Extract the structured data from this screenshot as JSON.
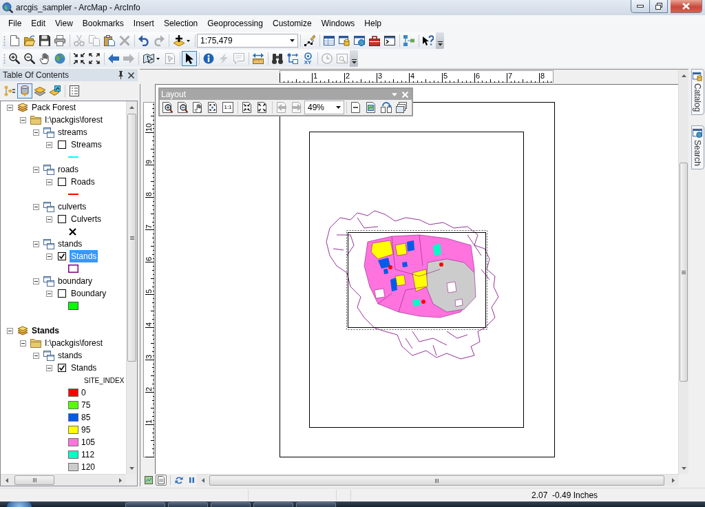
{
  "window": {
    "title": "arcgis_sampler - ArcMap - ArcInfo"
  },
  "menu": [
    "File",
    "Edit",
    "View",
    "Bookmarks",
    "Insert",
    "Selection",
    "Geoprocessing",
    "Customize",
    "Windows",
    "Help"
  ],
  "standard_toolbar": {
    "tools": [
      {
        "disabled": false
      },
      {
        "disabled": false
      },
      {
        "disabled": false
      },
      {
        "disabled": false
      },
      {
        "disabled": true
      },
      {
        "disabled": true
      },
      {
        "disabled": false
      },
      {
        "disabled": true
      },
      {
        "disabled": false
      },
      {
        "disabled": true
      },
      {
        "disabled": false
      },
      {
        "disabled": false
      },
      {
        "disabled": false
      },
      {
        "disabled": false
      },
      {
        "disabled": false
      },
      {
        "disabled": false
      },
      {
        "disabled": false
      },
      {
        "disabled": false
      },
      {
        "disabled": false
      }
    ],
    "scale": "1:75,479"
  },
  "tools_toolbar": {
    "tools": [
      {
        "disabled": false,
        "selected": false
      },
      {
        "disabled": false,
        "selected": false
      },
      {
        "disabled": false,
        "selected": false
      },
      {
        "disabled": false,
        "selected": false
      },
      {
        "disabled": false,
        "selected": false
      },
      {
        "disabled": false,
        "selected": false
      },
      {
        "disabled": false,
        "selected": false
      },
      {
        "disabled": true,
        "selected": false
      },
      {
        "disabled": false,
        "selected": false
      },
      {
        "disabled": true,
        "selected": false
      },
      {
        "disabled": false,
        "selected": true
      },
      {
        "disabled": false,
        "selected": false
      },
      {
        "disabled": true,
        "selected": false
      },
      {
        "disabled": true,
        "selected": false
      },
      {
        "disabled": false,
        "selected": false
      },
      {
        "disabled": false,
        "selected": false
      },
      {
        "disabled": false,
        "selected": false
      },
      {
        "disabled": false,
        "selected": false,
        "label": "XY"
      },
      {
        "disabled": true,
        "selected": false
      },
      {
        "disabled": true,
        "selected": false
      }
    ]
  },
  "table_of_contents": {
    "title": "Table Of Contents",
    "view_buttons": [
      {
        "selected": false
      },
      {
        "selected": true
      },
      {
        "selected": false
      },
      {
        "selected": false
      }
    ],
    "tree": [
      {
        "kind": "data_frame",
        "label": "Pack Forest",
        "active": false,
        "expanded": true,
        "children": [
          {
            "kind": "folder",
            "label": "I:\\packgis\\forest",
            "expanded": true,
            "children": [
              {
                "kind": "group",
                "label": "streams",
                "expanded": true,
                "children": [
                  {
                    "kind": "layer",
                    "label": "Streams",
                    "checked": false,
                    "selected": false,
                    "expanded": true,
                    "symbol": {
                      "kind": "line",
                      "color": "#00ffff"
                    }
                  }
                ]
              },
              {
                "kind": "group",
                "label": "roads",
                "expanded": true,
                "children": [
                  {
                    "kind": "layer",
                    "label": "Roads",
                    "checked": false,
                    "selected": false,
                    "expanded": true,
                    "symbol": {
                      "kind": "line",
                      "color": "#ff0000"
                    }
                  }
                ]
              },
              {
                "kind": "group",
                "label": "culverts",
                "expanded": true,
                "children": [
                  {
                    "kind": "layer",
                    "label": "Culverts",
                    "checked": false,
                    "selected": false,
                    "expanded": true,
                    "symbol": {
                      "kind": "cross",
                      "color": "#000000"
                    }
                  }
                ]
              },
              {
                "kind": "group",
                "label": "stands",
                "expanded": true,
                "children": [
                  {
                    "kind": "layer",
                    "label": "Stands",
                    "checked": true,
                    "selected": true,
                    "expanded": true,
                    "symbol": {
                      "kind": "outline",
                      "color": "#800080"
                    }
                  }
                ]
              },
              {
                "kind": "group",
                "label": "boundary",
                "expanded": true,
                "children": [
                  {
                    "kind": "layer",
                    "label": "Boundary",
                    "checked": false,
                    "selected": false,
                    "expanded": true,
                    "symbol": {
                      "kind": "fill",
                      "color": "#00ff00"
                    }
                  }
                ]
              }
            ]
          }
        ]
      },
      {
        "kind": "data_frame",
        "label": "Stands",
        "active": true,
        "expanded": true,
        "children": [
          {
            "kind": "folder",
            "label": "I:\\packgis\\forest",
            "expanded": true,
            "children": [
              {
                "kind": "group",
                "label": "stands",
                "expanded": true,
                "children": [
                  {
                    "kind": "layer",
                    "label": "Stands",
                    "checked": true,
                    "selected": false,
                    "expanded": true,
                    "legend": {
                      "heading": "SITE_INDEX",
                      "classes": [
                        {
                          "label": "0",
                          "color": "#ff0000"
                        },
                        {
                          "label": "75",
                          "color": "#55ff00"
                        },
                        {
                          "label": "85",
                          "color": "#005ce6"
                        },
                        {
                          "label": "95",
                          "color": "#ffff00"
                        },
                        {
                          "label": "105",
                          "color": "#ff73df"
                        },
                        {
                          "label": "112",
                          "color": "#00ffc5"
                        },
                        {
                          "label": "120",
                          "color": "#cccccc"
                        }
                      ]
                    }
                  }
                ]
              }
            ]
          }
        ]
      }
    ]
  },
  "layout_view": {
    "horizontal_ruler": [
      "1",
      "2",
      "3",
      "4",
      "5",
      "6",
      "7",
      "8"
    ],
    "vertical_ruler": [
      "10",
      "9",
      "8",
      "7",
      "6",
      "5",
      "4",
      "3",
      "2",
      "1"
    ],
    "layout_toolbar": {
      "title": "Layout",
      "tools": [
        {
          "disabled": false
        },
        {
          "disabled": false
        },
        {
          "disabled": false
        },
        {
          "disabled": false
        },
        {
          "disabled": false,
          "label": "1:1"
        },
        {
          "disabled": false
        },
        {
          "disabled": false
        },
        {
          "disabled": true
        },
        {
          "disabled": true
        },
        {
          "disabled": false
        },
        {
          "disabled": false
        },
        {
          "disabled": false
        },
        {
          "disabled": false
        }
      ],
      "zoom": "49%"
    },
    "view_switch": [
      {
        "selected": false
      },
      {
        "selected": true
      }
    ]
  },
  "dock_tabs": [
    {
      "label": "Catalog"
    },
    {
      "label": "Search"
    }
  ],
  "status_bar": {
    "coordinates": "2.07  -0.49 Inches"
  }
}
